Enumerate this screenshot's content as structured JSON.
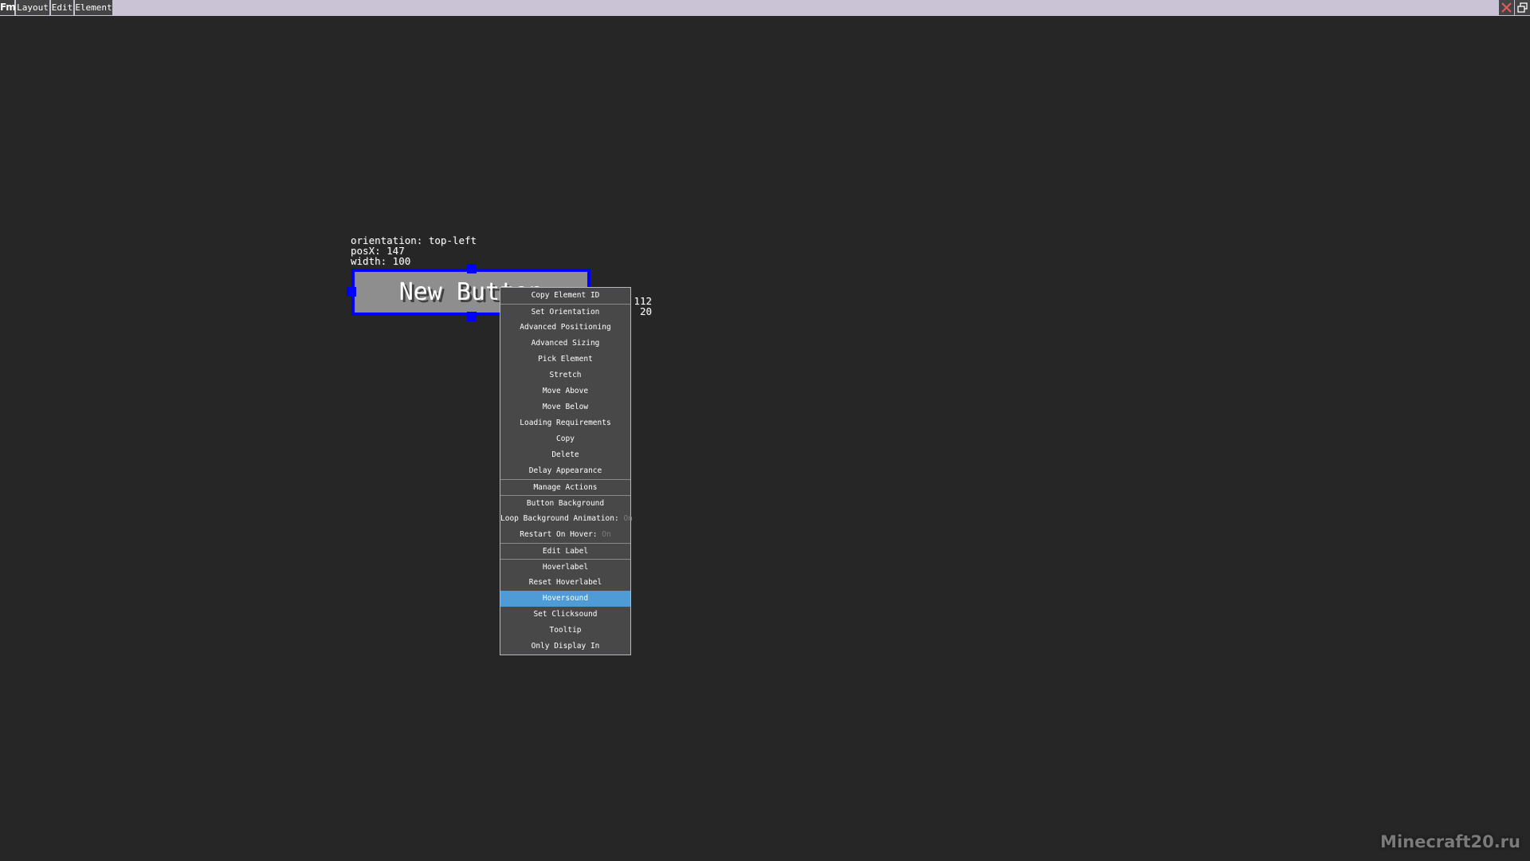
{
  "topbar": {
    "logo_text": "Fm",
    "menus": [
      {
        "label": "Layout"
      },
      {
        "label": "Edit"
      },
      {
        "label": "Element"
      }
    ],
    "close_icon": "close-icon",
    "restore_icon": "restore-window-icon",
    "colors": {
      "bar": "#cac3d6",
      "button": "#444444",
      "close": "#e35a5a"
    }
  },
  "element_info": {
    "orientation": "orientation: top-left",
    "posx": "posX: 147",
    "width": "width: 100",
    "posy_value": "112",
    "height_value": "20"
  },
  "element": {
    "label": "New Button",
    "border_color": "#0000ff",
    "background_color": "#8e8e8e"
  },
  "context_menu": {
    "highlight_color": "#4e9bd6",
    "items": [
      {
        "label": "Copy Element ID"
      },
      {
        "label": "Set Orientation"
      },
      {
        "label": "Advanced Positioning"
      },
      {
        "label": "Advanced Sizing"
      },
      {
        "label": "Pick Element"
      },
      {
        "label": "Stretch"
      },
      {
        "label": "Move Above"
      },
      {
        "label": "Move Below"
      },
      {
        "label": "Loading Requirements"
      },
      {
        "label": "Copy"
      },
      {
        "label": "Delete"
      },
      {
        "label": "Delay Appearance"
      },
      {
        "label": "Manage Actions"
      },
      {
        "label": "Button Background"
      },
      {
        "label": "Loop Background Animation: ",
        "value": "On"
      },
      {
        "label": "Restart On Hover: ",
        "value": "On"
      },
      {
        "label": "Edit Label"
      },
      {
        "label": "Hoverlabel"
      },
      {
        "label": "Reset Hoverlabel"
      },
      {
        "label": "Hoversound",
        "active": true
      },
      {
        "label": "Set Clicksound"
      },
      {
        "label": "Tooltip"
      },
      {
        "label": "Only Display In"
      }
    ]
  },
  "watermark": "Minecraft20.ru"
}
